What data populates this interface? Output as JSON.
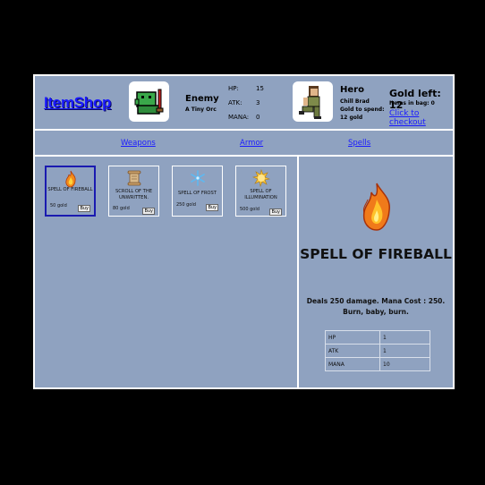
{
  "logo": "ItemShop",
  "enemy": {
    "name": "Enemy",
    "subtitle": "A Tiny Orc",
    "stats": [
      {
        "label": "HP:",
        "value": "15"
      },
      {
        "label": "ATK:",
        "value": "3"
      },
      {
        "label": "MANA:",
        "value": "0"
      }
    ]
  },
  "hero": {
    "name": "Hero",
    "subtitle": "Chill Brad",
    "gold_label": "Gold to spend:",
    "gold_value": "12 gold"
  },
  "gold": {
    "title": "Gold left: 12",
    "bag": "Items in bag: 0",
    "checkout": "Click to checkout"
  },
  "nav": {
    "weapons": "Weapons",
    "armor": "Armor",
    "spells": "Spells"
  },
  "items": [
    {
      "name": "SPELL OF FIREBALL",
      "price": "50 gold",
      "buy": "Buy",
      "icon": "fire-icon"
    },
    {
      "name": "SCROLL OF THE UNWRITTEN.",
      "price": "80 gold",
      "buy": "Buy",
      "icon": "scroll-icon"
    },
    {
      "name": "SPELL OF FROST",
      "price": "250 gold",
      "buy": "Buy",
      "icon": "snowflake-icon"
    },
    {
      "name": "SPELL OF ILLUMINATION",
      "price": "500 gold",
      "buy": "Buy",
      "icon": "sun-icon"
    }
  ],
  "detail": {
    "title": "SPELL OF FIREBALL",
    "description": "Deals 250 damage. Mana Cost : 250. Burn, baby, burn.",
    "stats": [
      {
        "label": "HP",
        "value": "1"
      },
      {
        "label": "ATK",
        "value": "1"
      },
      {
        "label": "MANA",
        "value": "10"
      }
    ]
  },
  "colors": {
    "background": "#8fa2c0",
    "link": "#1a1aff",
    "page": "#000000"
  }
}
